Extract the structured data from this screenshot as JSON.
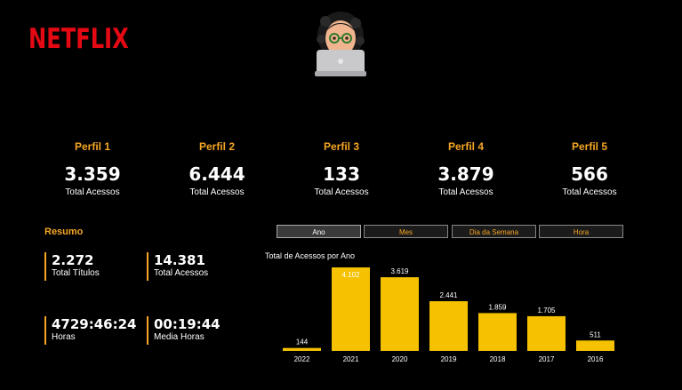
{
  "brand": {
    "logo_text": "NETFLIX",
    "accent": "#E50914"
  },
  "avatar": {
    "icon": "memoji-with-laptop-icon"
  },
  "profiles": [
    {
      "name": "Perfil 1",
      "value": "3.359",
      "label": "Total Acessos"
    },
    {
      "name": "Perfil 2",
      "value": "6.444",
      "label": "Total Acessos"
    },
    {
      "name": "Perfil 3",
      "value": "133",
      "label": "Total Acessos"
    },
    {
      "name": "Perfil 4",
      "value": "3.879",
      "label": "Total Acessos"
    },
    {
      "name": "Perfil 5",
      "value": "566",
      "label": "Total Acessos"
    }
  ],
  "resumo": {
    "title": "Resumo",
    "kpis": [
      {
        "value": "2.272",
        "label": "Total Títulos"
      },
      {
        "value": "14.381",
        "label": "Total Acessos"
      },
      {
        "value": "4729:46:24",
        "label": "Horas"
      },
      {
        "value": "00:19:44",
        "label": "Media Horas"
      }
    ]
  },
  "tabs": [
    {
      "label": "Ano",
      "active": true
    },
    {
      "label": "Mes",
      "active": false
    },
    {
      "label": "Dia da Semana",
      "active": false
    },
    {
      "label": "Hora",
      "active": false
    }
  ],
  "colors": {
    "accent": "#F5A623",
    "bar": "#F5C100"
  },
  "chart_data": {
    "type": "bar",
    "title": "Total de Acessos por Ano",
    "categories": [
      "2022",
      "2021",
      "2020",
      "2019",
      "2018",
      "2017",
      "2016"
    ],
    "values": [
      144,
      4102,
      3619,
      2441,
      1859,
      1705,
      511
    ],
    "value_labels": [
      "144",
      "4.102",
      "3.619",
      "2.441",
      "1.859",
      "1.705",
      "511"
    ],
    "xlabel": "",
    "ylabel": "",
    "grid": false,
    "legend": "none"
  }
}
